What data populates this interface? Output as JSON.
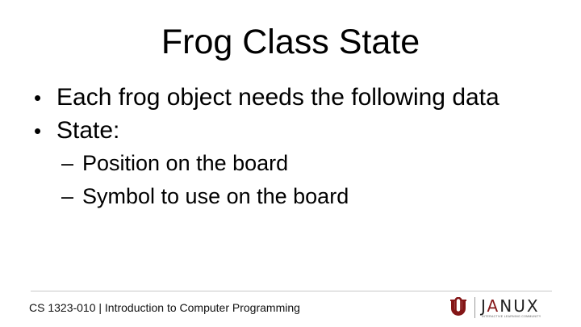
{
  "slide": {
    "title": "Frog Class State",
    "bullets": [
      {
        "marker": "•",
        "text": "Each frog object needs the following data"
      },
      {
        "marker": "•",
        "text": "State:"
      }
    ],
    "sub_bullets": [
      {
        "marker": "–",
        "text": "Position on the board"
      },
      {
        "marker": "–",
        "text": "Symbol to use on the board"
      }
    ]
  },
  "footer": {
    "course": "CS 1323-010 | Introduction to Computer Programming",
    "logo_text_j": "J",
    "logo_text_a": "A",
    "logo_text_rest": "NUX",
    "tagline": "INTERACTIVE LEARNING COMMUNITY"
  },
  "colors": {
    "text": "#000000",
    "footer_rule": "#c8c8c8",
    "brand_crimson": "#841617"
  }
}
